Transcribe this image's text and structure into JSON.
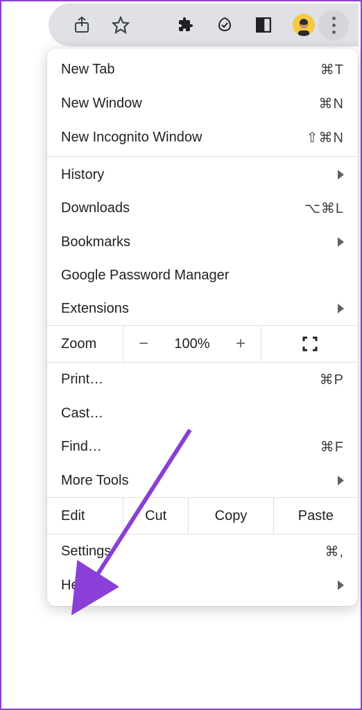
{
  "toolbar": {
    "share_icon": "share-icon",
    "star_icon": "star-icon",
    "extensions_icon": "puzzle-icon",
    "leaf_icon": "eco-icon",
    "panel_icon": "panel-icon",
    "avatar": "profile-avatar",
    "more_icon": "dots-vertical-icon"
  },
  "menu": {
    "new_tab": {
      "label": "New Tab",
      "shortcut": "⌘T"
    },
    "new_window": {
      "label": "New Window",
      "shortcut": "⌘N"
    },
    "new_incognito": {
      "label": "New Incognito Window",
      "shortcut": "⇧⌘N"
    },
    "history": {
      "label": "History"
    },
    "downloads": {
      "label": "Downloads",
      "shortcut": "⌥⌘L"
    },
    "bookmarks": {
      "label": "Bookmarks"
    },
    "password_manager": {
      "label": "Google Password Manager"
    },
    "extensions": {
      "label": "Extensions"
    },
    "zoom": {
      "label": "Zoom",
      "value": "100%",
      "minus": "−",
      "plus": "+"
    },
    "print": {
      "label": "Print…",
      "shortcut": "⌘P"
    },
    "cast": {
      "label": "Cast…"
    },
    "find": {
      "label": "Find…",
      "shortcut": "⌘F"
    },
    "more_tools": {
      "label": "More Tools"
    },
    "edit": {
      "label": "Edit",
      "cut": "Cut",
      "copy": "Copy",
      "paste": "Paste"
    },
    "settings": {
      "label": "Settings",
      "shortcut": "⌘,"
    },
    "help": {
      "label": "Help"
    }
  },
  "annotation": {
    "color": "#8a3fd6"
  }
}
